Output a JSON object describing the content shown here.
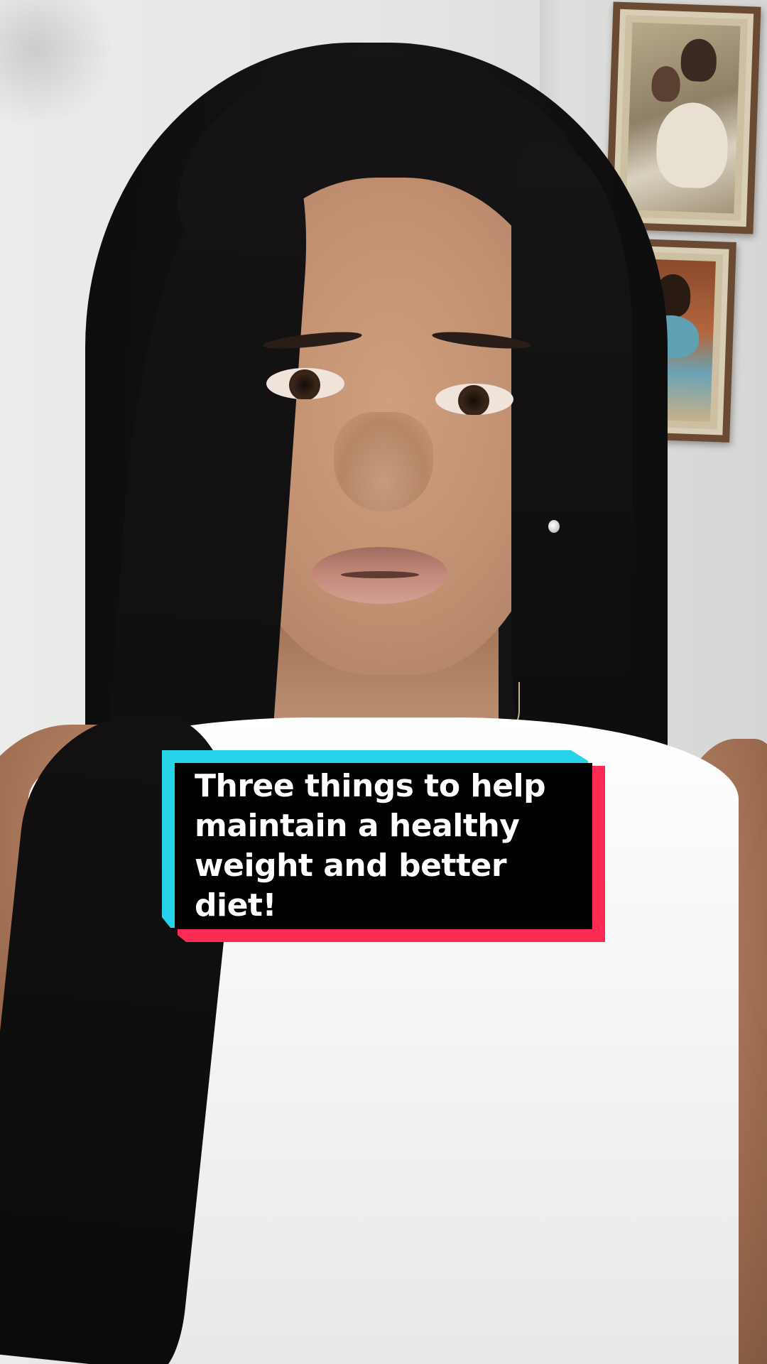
{
  "caption": {
    "line1": "Three things to help",
    "line2": "maintain a healthy",
    "line3": "weight and better diet!"
  },
  "colors": {
    "caption_background": "#000000",
    "caption_text": "#ffffff",
    "caption_accent_cyan": "#27d3e8",
    "caption_accent_red": "#fe2c55"
  }
}
